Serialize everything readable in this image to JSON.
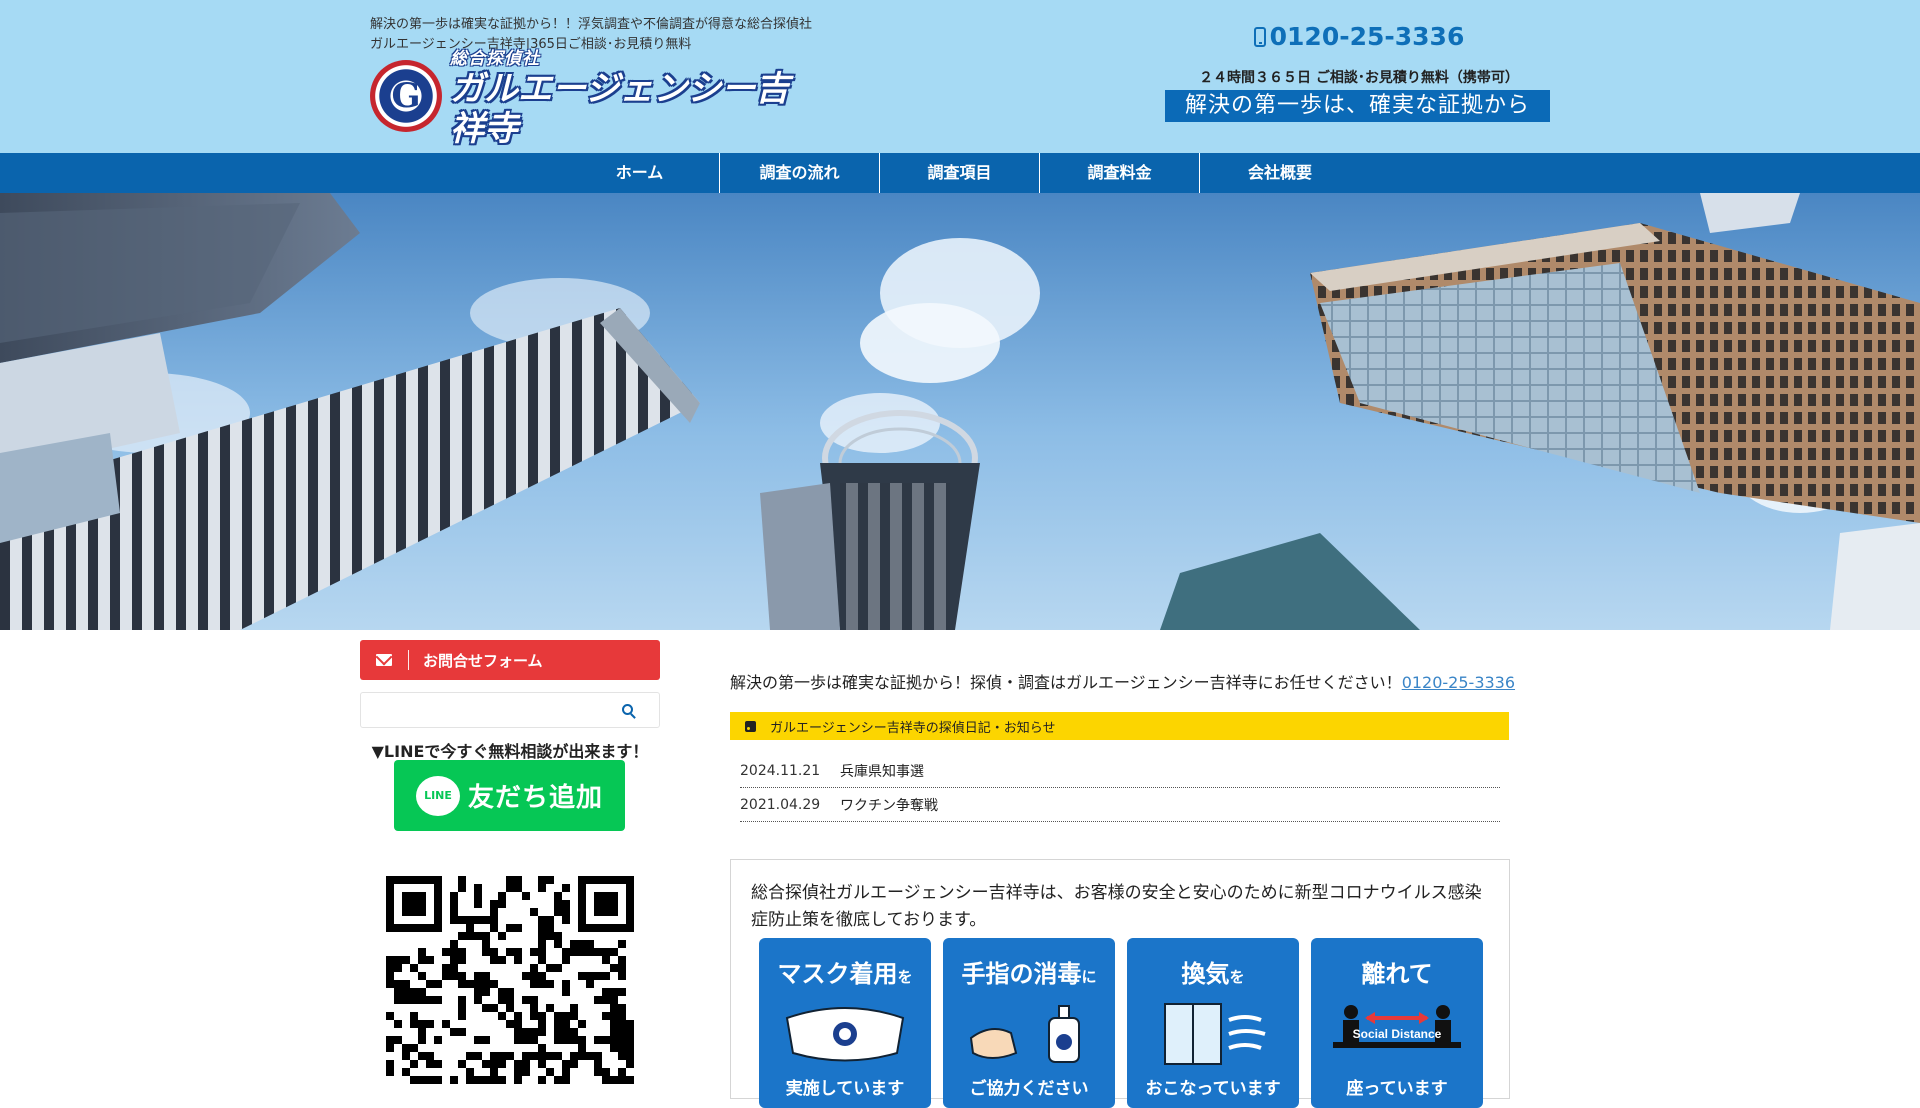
{
  "header": {
    "tagline_line1": "解決の第一歩は確実な証拠から！！浮気調査や不倫調査が得意な総合探偵社",
    "tagline_line2": "ガルエージェンシー吉祥寺|365日ご相談･お見積り無料",
    "logo_sub": "総合探偵社",
    "logo_main": "ガルエージェンシー吉祥寺",
    "logo_mark": "G",
    "phone": "0120-25-3336",
    "hours": "２４時間３６５日 ご相談･お見積り無料（携帯可）",
    "catch": "解決の第一歩は、確実な証拠から"
  },
  "nav": {
    "items": [
      {
        "label": "ホーム"
      },
      {
        "label": "調査の流れ"
      },
      {
        "label": "調査項目"
      },
      {
        "label": "調査料金"
      },
      {
        "label": "会社概要"
      }
    ]
  },
  "sidebar": {
    "contact_label": "お問合せフォーム",
    "search_placeholder": "",
    "line_text": "▼LINEで今すぐ無料相談が出来ます！",
    "line_logo": "LINE",
    "line_button": "友だち追加"
  },
  "main": {
    "intro_text": "解決の第一歩は確実な証拠から！探偵・調査はガルエージェンシー吉祥寺にお任せください！",
    "intro_phone": "0120-25-3336",
    "news_header": "ガルエージェンシー吉祥寺の探偵日記・お知らせ",
    "news": [
      {
        "date": "2024.11.21",
        "title": "兵庫県知事選"
      },
      {
        "date": "2021.04.29",
        "title": "ワクチン争奪戦"
      }
    ],
    "covid_text": "総合探偵社ガルエージェンシー吉祥寺は、お客様の安全と安心のために新型コロナウイルス感染症防止策を徹底しております。",
    "covid_cards": [
      {
        "title": "マスク着用",
        "particle": "を",
        "foot": "実施しています"
      },
      {
        "title": "手指の消毒",
        "particle": "に",
        "foot": "ご協力ください"
      },
      {
        "title": "換気",
        "particle": "を",
        "foot": "おこなっています"
      },
      {
        "title": "離れて",
        "particle": "",
        "foot": "座っています",
        "badge": "Social Distance"
      }
    ]
  },
  "colors": {
    "header_bg": "#a6daf4",
    "nav_bg": "#0a64ad",
    "contact_red": "#e7393a",
    "line_green": "#06c755",
    "news_yellow": "#fcd500",
    "card_blue": "#1b75c9"
  }
}
